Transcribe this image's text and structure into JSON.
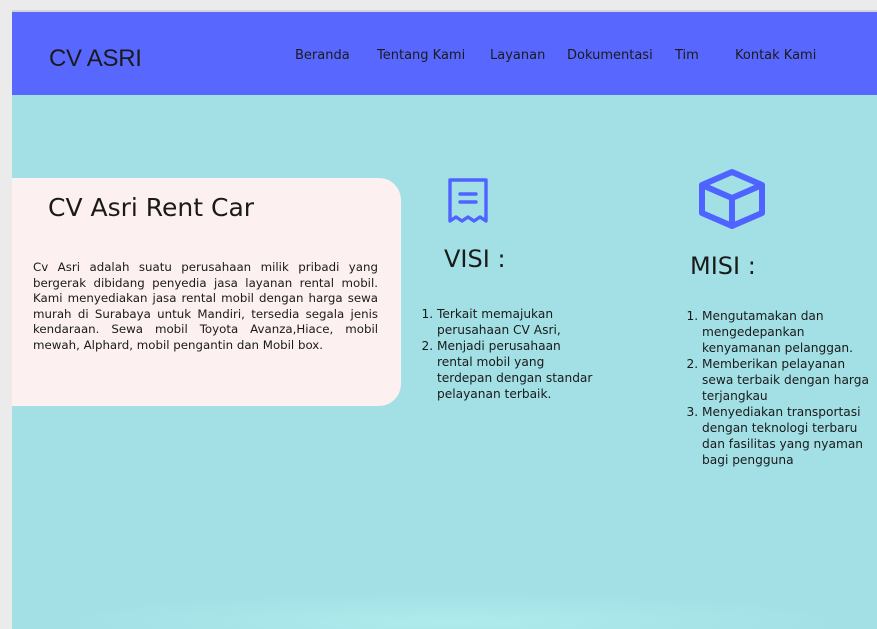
{
  "header": {
    "brand": "CV ASRI",
    "nav": [
      {
        "label": "Beranda"
      },
      {
        "label": "Tentang Kami"
      },
      {
        "label": "Layanan"
      },
      {
        "label": "Dokumentasi"
      },
      {
        "label": "Tim"
      },
      {
        "label": "Kontak Kami"
      }
    ]
  },
  "about": {
    "title": "CV Asri Rent Car",
    "text": "Cv Asri adalah suatu perusahaan milik pribadi yang bergerak dibidang penyedia jasa layanan rental mobil. Kami menyediakan jasa rental mobil dengan harga sewa murah di Surabaya untuk Mandiri, tersedia segala jenis kendaraan. Sewa mobil Toyota Avanza,Hiace, mobil mewah, Alphard, mobil pengantin dan Mobil box."
  },
  "visi": {
    "icon": "document-icon",
    "title": "VISI :",
    "items": [
      "Terkait memajukan perusahaan CV Asri,",
      "Menjadi perusahaan rental mobil yang terdepan dengan standar pelayanan terbaik."
    ]
  },
  "misi": {
    "icon": "cube-icon",
    "title": "MISI :",
    "items": [
      "Mengutamakan dan mengedepankan kenyamanan pelanggan.",
      "Memberikan pelayanan sewa terbaik dengan harga terjangkau",
      "Menyediakan transportasi dengan teknologi terbaru dan fasilitas yang nyaman bagi pengguna"
    ]
  },
  "colors": {
    "navbar": "#5868ff",
    "page": "#a2e0e6",
    "card": "#fdf0f0",
    "icon": "#4e63ff"
  }
}
